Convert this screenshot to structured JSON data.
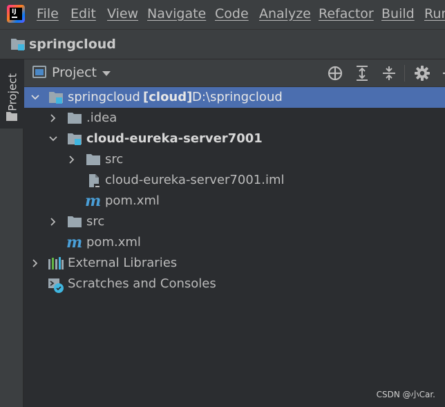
{
  "menu": {
    "items": [
      "File",
      "Edit",
      "View",
      "Navigate",
      "Code",
      "Analyze",
      "Refactor",
      "Build",
      "Run"
    ],
    "logo_text": "IJ"
  },
  "navbar": {
    "title": "springcloud"
  },
  "toolstrip": {
    "project_tab": "Project"
  },
  "panel": {
    "title": "Project"
  },
  "tree": {
    "root": {
      "name": "springcloud",
      "module": "[cloud]",
      "path": "D:\\springcloud"
    },
    "idea": ".idea",
    "module": "cloud-eureka-server7001",
    "module_src": "src",
    "module_iml": "cloud-eureka-server7001.iml",
    "module_pom": "pom.xml",
    "src": "src",
    "pom": "pom.xml",
    "external_libraries": "External Libraries",
    "scratches": "Scratches and Consoles"
  },
  "watermark": "CSDN @小Car.",
  "colors": {
    "selection": "#4b6eaf",
    "folder": "#9aa7b0",
    "module_marker": "#40b6e0",
    "maven": "#4a9fd8"
  }
}
